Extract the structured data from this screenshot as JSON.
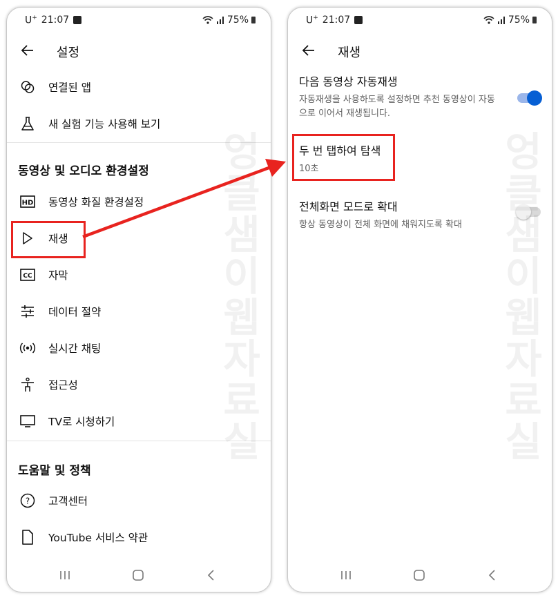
{
  "colors": {
    "accent": "#065fd4",
    "annotation": "#e8231f"
  },
  "status_bar": {
    "carrier": "U",
    "carrier_sup": "+",
    "time": "21:07",
    "battery": "75%"
  },
  "left_screen": {
    "title": "설정",
    "items_top": [
      {
        "icon": "connected-apps-icon",
        "label": "연결된 앱"
      },
      {
        "icon": "flask-icon",
        "label": "새 실험 기능 사용해 보기"
      }
    ],
    "section_video": {
      "heading": "동영상 및 오디오 환경설정",
      "items": [
        {
          "icon": "hd-icon",
          "label": "동영상 화질 환경설정"
        },
        {
          "icon": "play-icon",
          "label": "재생"
        },
        {
          "icon": "captions-icon",
          "label": "자막"
        },
        {
          "icon": "data-saver-icon",
          "label": "데이터 절약"
        },
        {
          "icon": "live-chat-icon",
          "label": "실시간 채팅"
        },
        {
          "icon": "accessibility-icon",
          "label": "접근성"
        },
        {
          "icon": "tv-icon",
          "label": "TV로 시청하기"
        }
      ]
    },
    "section_help": {
      "heading": "도움말 및 정책",
      "items": [
        {
          "icon": "help-icon",
          "label": "고객센터"
        },
        {
          "icon": "document-icon",
          "label": "YouTube 서비스 약관"
        }
      ]
    }
  },
  "right_screen": {
    "title": "재생",
    "settings": [
      {
        "title": "다음 동영상 자동재생",
        "subtitle": "자동재생을 사용하도록 설정하면 추천 동영상이 자동으로 이어서 재생됩니다.",
        "toggle": "on"
      },
      {
        "title": "두 번 탭하여 탐색",
        "subtitle": "10초"
      },
      {
        "title": "전체화면 모드로 확대",
        "subtitle": "항상 동영상이 전체 화면에 채워지도록 확대",
        "toggle": "off"
      }
    ]
  },
  "watermark": "엉클샘이웹자료실"
}
